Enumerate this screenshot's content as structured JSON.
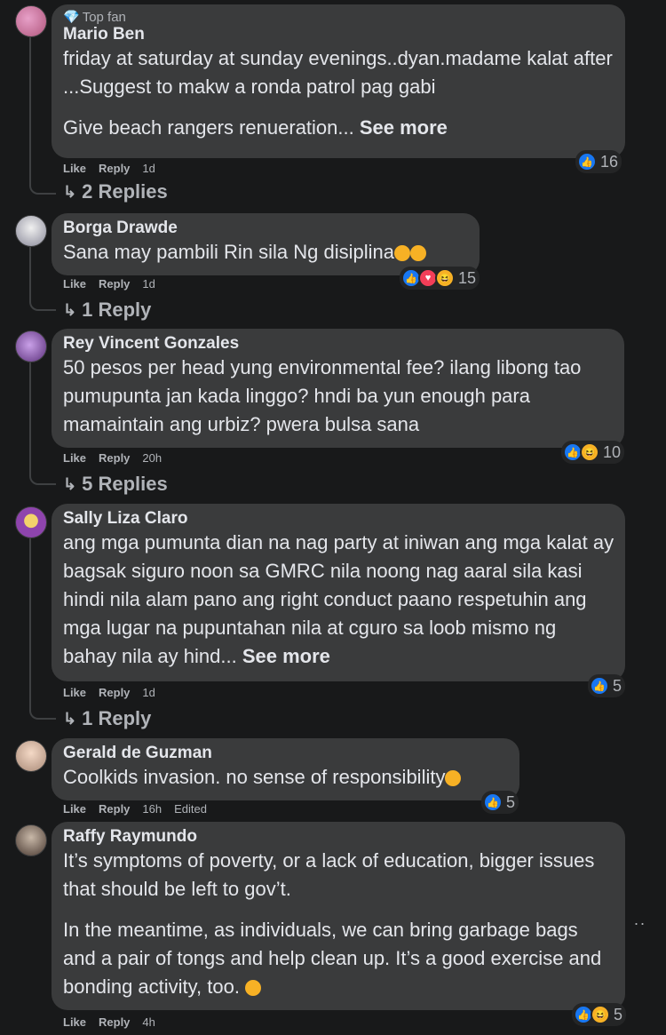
{
  "comments": [
    {
      "badge": "Top fan",
      "author": "Mario Ben",
      "paragraphs": [
        "friday at saturday at sunday evenings..dyan.madame kalat after ...Suggest to makw a ronda patrol pag gabi",
        "Give beach rangers renueration... "
      ],
      "see_more": "See more",
      "like": "Like",
      "reply": "Reply",
      "time": "1d",
      "reaction_count": "16",
      "replies": "2 Replies"
    },
    {
      "author": "Borga Drawde",
      "paragraphs": [
        "Sana may pambili Rin sila Ng disiplina"
      ],
      "like": "Like",
      "reply": "Reply",
      "time": "1d",
      "reaction_count": "15",
      "replies": "1 Reply"
    },
    {
      "author": "Rey Vincent Gonzales",
      "paragraphs": [
        "50 pesos per head yung environmental fee? ilang libong tao pumupunta jan kada linggo? hndi ba yun enough para mamaintain ang urbiz? pwera bulsa sana"
      ],
      "like": "Like",
      "reply": "Reply",
      "time": "20h",
      "reaction_count": "10",
      "replies": "5 Replies"
    },
    {
      "author": "Sally Liza Claro",
      "paragraphs": [
        "ang mga pumunta dian na nag party at iniwan ang mga kalat ay bagsak siguro noon sa GMRC nila noong nag aaral sila kasi hindi nila alam pano ang right conduct paano respetuhin ang mga lugar na pupuntahan nila at cguro sa loob mismo ng bahay nila ay hind... "
      ],
      "see_more": "See more",
      "like": "Like",
      "reply": "Reply",
      "time": "1d",
      "reaction_count": "5",
      "replies": "1 Reply"
    },
    {
      "author": "Gerald de Guzman",
      "paragraphs": [
        "Coolkids invasion. no sense of responsibility"
      ],
      "like": "Like",
      "reply": "Reply",
      "time": "16h",
      "edited": "Edited",
      "reaction_count": "5"
    },
    {
      "author": "Raffy Raymundo",
      "paragraphs": [
        "It’s symptoms of poverty, or a lack of education, bigger issues that should be left to gov’t.",
        "In the meantime, as individuals, we can bring garbage bags and a pair of tongs and help clean up. It’s a good exercise and bonding activity, too. "
      ],
      "like": "Like",
      "reply": "Reply",
      "time": "4h",
      "reaction_count": "5"
    }
  ],
  "more_options": "..",
  "colors": {
    "background": "#18191a",
    "bubble": "#3a3b3c",
    "like_blue": "#1877f2",
    "love_red": "#f33e58",
    "emoji_yellow": "#f7b125"
  }
}
